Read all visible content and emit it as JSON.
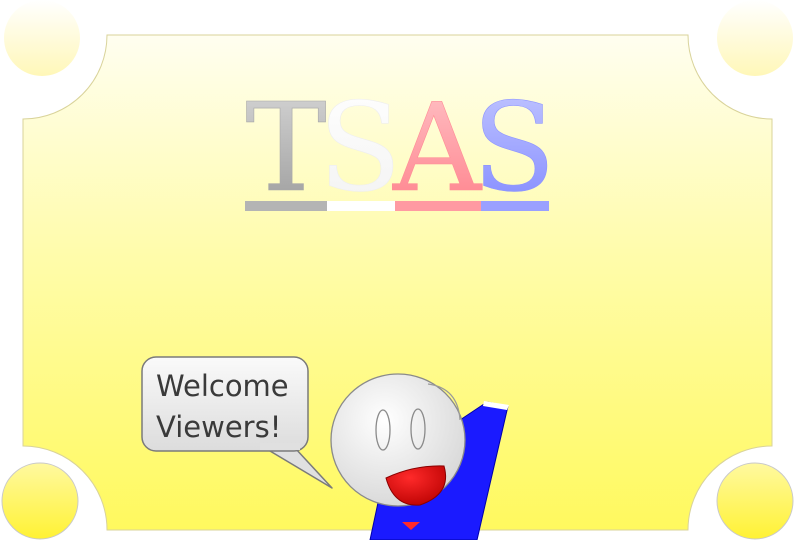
{
  "title": {
    "letters": [
      "T",
      "S",
      "A",
      "S"
    ]
  },
  "speech_bubble": {
    "line1": "Welcome",
    "line2": "Viewers!"
  },
  "colors": {
    "card_top": "#fffde6",
    "card_bottom": "#fff86a",
    "letter_t": "#b0b0b0",
    "letter_s1": "#ffffff",
    "letter_a": "#ff9aa2",
    "letter_s2": "#9aa0ff",
    "character_body": "#1a1aff",
    "character_mouth": "#dd0000"
  }
}
